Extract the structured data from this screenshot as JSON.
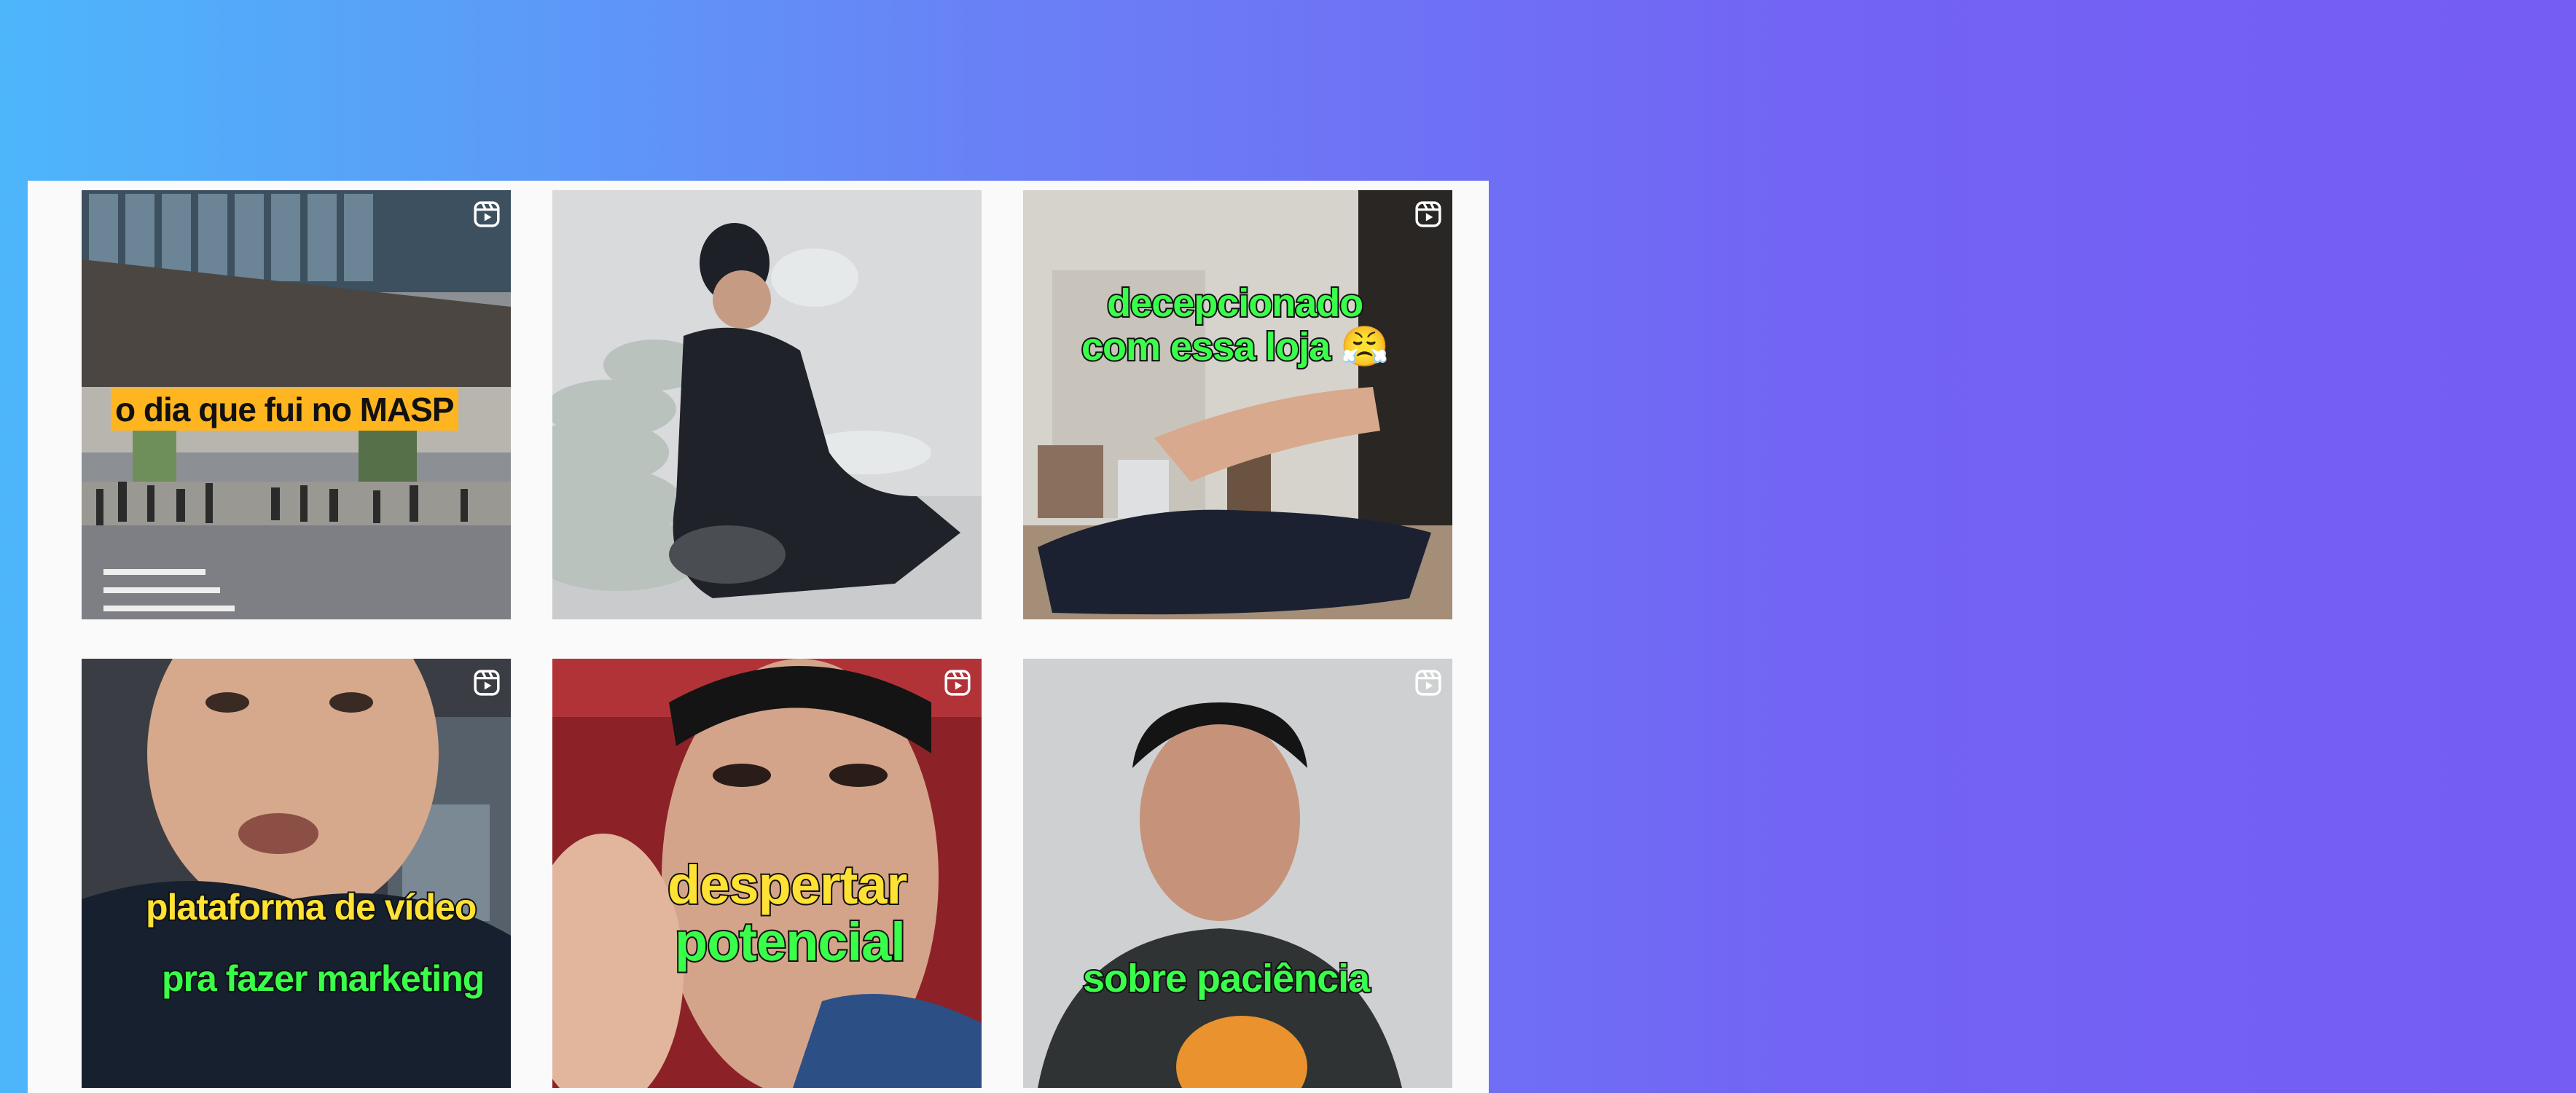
{
  "colors": {
    "background_start": "#4db6fb",
    "background_end": "#755cf3",
    "panel": "#fafafa",
    "caption_yellow": "#ffe234",
    "caption_green": "#39ff4a",
    "caption_label_bg": "#ffb51f"
  },
  "grid": {
    "icon": "reels-icon",
    "posts": [
      {
        "caption_lines": [
          "o dia que fui no MASP"
        ],
        "has_reels_icon": true
      },
      {
        "caption_lines": [],
        "has_reels_icon": false
      },
      {
        "caption_lines": [
          "decepcionado",
          "com essa loja 😤"
        ],
        "has_reels_icon": true
      },
      {
        "caption_lines": [
          "plataforma de vídeo",
          "pra fazer marketing"
        ],
        "has_reels_icon": true
      },
      {
        "caption_lines": [
          "despertar",
          "potencial"
        ],
        "has_reels_icon": true
      },
      {
        "caption_lines": [
          "sobre paciência"
        ],
        "has_reels_icon": true
      }
    ]
  }
}
